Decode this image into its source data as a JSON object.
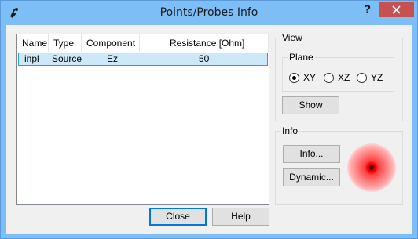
{
  "window": {
    "title": "Points/Probes Info",
    "help_glyph": "?",
    "close_glyph": "✕"
  },
  "list": {
    "columns": [
      "Name",
      "Type",
      "Component",
      "Resistance [Ohm]"
    ],
    "rows": [
      {
        "name": "inpl",
        "type": "Source",
        "component": "Ez",
        "resistance": "50"
      }
    ]
  },
  "view": {
    "legend": "View",
    "plane": {
      "legend": "Plane",
      "options": [
        "XY",
        "XZ",
        "YZ"
      ],
      "selected": "XY"
    },
    "show_label": "Show"
  },
  "info": {
    "legend": "Info",
    "info_label": "Info...",
    "dynamic_label": "Dynamic...",
    "probe_icon": "probe-marker-icon"
  },
  "footer": {
    "close_label": "Close",
    "help_label": "Help"
  },
  "colors": {
    "titlebar": "#7cbef5",
    "close_button": "#c75050",
    "selection": "#cde8f8",
    "probe_red": "#e60000"
  }
}
